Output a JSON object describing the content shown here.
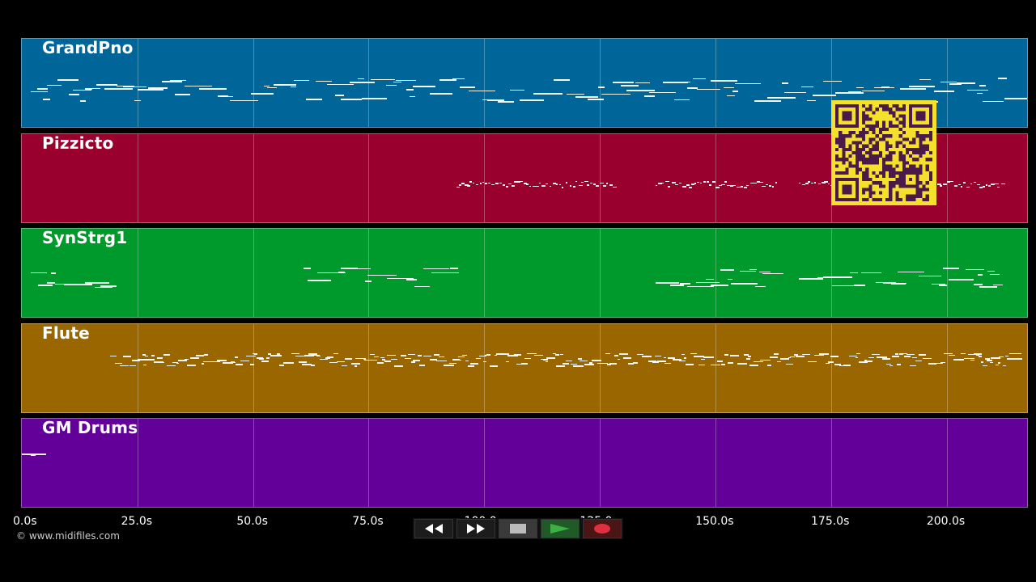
{
  "tracks": [
    {
      "name": "GrandPno",
      "color": "#006699"
    },
    {
      "name": "Pizzicto",
      "color": "#99002e"
    },
    {
      "name": "SynStrg1",
      "color": "#00992b"
    },
    {
      "name": "Flute",
      "color": "#996600"
    },
    {
      "name": "GM Drums",
      "color": "#630099"
    }
  ],
  "timeline": {
    "ticks": [
      "0.0s",
      "25.0s",
      "50.0s",
      "75.0s",
      "100.0s",
      "125.0s",
      "150.0s",
      "175.0s",
      "200.0s"
    ],
    "max_seconds": 218.5
  },
  "transport": {
    "rewind_icon": "rewind-icon",
    "fast_forward_icon": "fast-forward-icon",
    "stop_icon": "stop-icon",
    "play_icon": "play-icon",
    "record_icon": "record-icon",
    "play_color": "#3cb043",
    "record_color": "#e03040"
  },
  "copyright": "© www.midifiles.com"
}
